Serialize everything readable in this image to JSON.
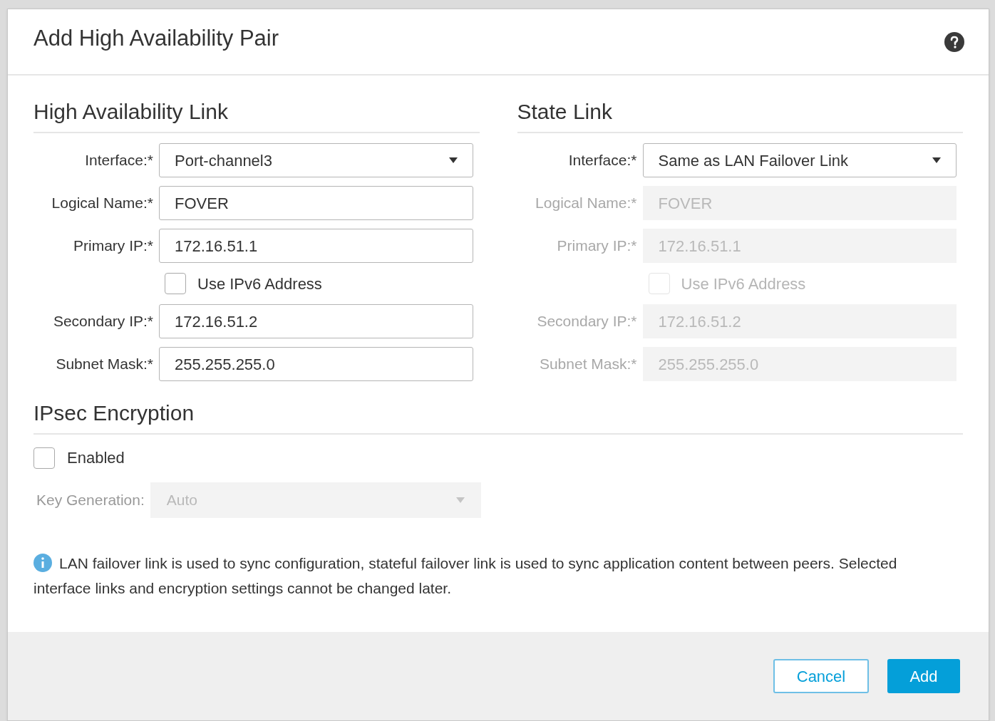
{
  "dialog_title": "Add High Availability Pair",
  "panels": [
    {
      "title": "High Availability Link",
      "fields": [
        {
          "kind": "select",
          "label": "Interface:*",
          "value": "Port-channel3",
          "disabled": false
        },
        {
          "kind": "text",
          "label": "Logical Name:*",
          "value": "FOVER",
          "disabled": false
        },
        {
          "kind": "text",
          "label": "Primary IP:*",
          "value": "172.16.51.1",
          "disabled": false
        },
        {
          "kind": "checkbox",
          "label": "Use IPv6 Address",
          "checked": false,
          "disabled": false
        },
        {
          "kind": "text",
          "label": "Secondary IP:*",
          "value": "172.16.51.2",
          "disabled": false
        },
        {
          "kind": "text",
          "label": "Subnet Mask:*",
          "value": "255.255.255.0",
          "disabled": false
        }
      ]
    },
    {
      "title": "State Link",
      "fields": [
        {
          "kind": "select",
          "label": "Interface:*",
          "value": "Same as LAN Failover Link",
          "disabled": false
        },
        {
          "kind": "text",
          "label": "Logical Name:*",
          "value": "FOVER",
          "disabled": true
        },
        {
          "kind": "text",
          "label": "Primary IP:*",
          "value": "172.16.51.1",
          "disabled": true
        },
        {
          "kind": "checkbox",
          "label": "Use IPv6 Address",
          "checked": false,
          "disabled": true
        },
        {
          "kind": "text",
          "label": "Secondary IP:*",
          "value": "172.16.51.2",
          "disabled": true
        },
        {
          "kind": "text",
          "label": "Subnet Mask:*",
          "value": "255.255.255.0",
          "disabled": true
        }
      ]
    }
  ],
  "ipsec": {
    "title": "IPsec Encryption",
    "enabled": {
      "label": "Enabled",
      "checked": false
    },
    "key_generation": {
      "label": "Key Generation:",
      "value": "Auto",
      "disabled": true
    }
  },
  "info": "LAN failover link is used to sync configuration, stateful failover link is used to sync application content between peers. Selected interface links and encryption settings cannot be changed later.",
  "buttons": [
    {
      "label": "Cancel",
      "kind": "secondary"
    },
    {
      "label": "Add",
      "kind": "primary"
    }
  ]
}
